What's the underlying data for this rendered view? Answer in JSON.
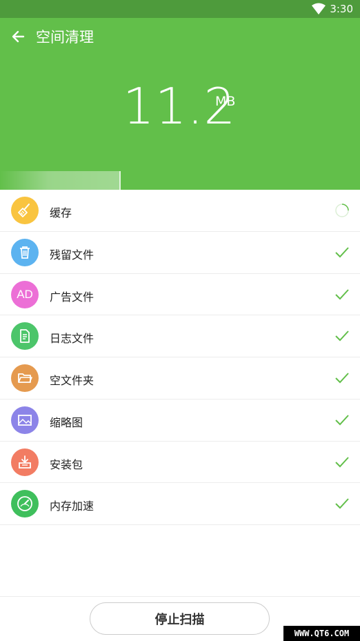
{
  "status_bar": {
    "time": "3:30",
    "wifi_icon": "wifi-icon"
  },
  "header": {
    "title": "空间清理",
    "size_value": "11.2",
    "size_unit": "MB",
    "back_icon": "arrow-left-icon",
    "background_color": "#62bf4a",
    "scan_progress": 0.335
  },
  "items": [
    {
      "label": "缓存",
      "icon": "broom-icon",
      "color": "#f9c440",
      "status": "scanning"
    },
    {
      "label": "残留文件",
      "icon": "trash-icon",
      "color": "#5cb3f0",
      "status": "done"
    },
    {
      "label": "广告文件",
      "icon": "ad-icon",
      "color": "#ec6fd6",
      "icon_text": "AD",
      "status": "done"
    },
    {
      "label": "日志文件",
      "icon": "document-icon",
      "color": "#4cc56a",
      "status": "done"
    },
    {
      "label": "空文件夹",
      "icon": "folder-icon",
      "color": "#e59a4f",
      "status": "done"
    },
    {
      "label": "缩略图",
      "icon": "image-icon",
      "color": "#8c84e8",
      "status": "done"
    },
    {
      "label": "安装包",
      "icon": "package-icon",
      "color": "#f27c63",
      "status": "done"
    },
    {
      "label": "内存加速",
      "icon": "speedometer-icon",
      "color": "#3fbf5c",
      "status": "done"
    }
  ],
  "footer": {
    "stop_label": "停止扫描"
  },
  "watermark": "WWW.QT6.COM"
}
